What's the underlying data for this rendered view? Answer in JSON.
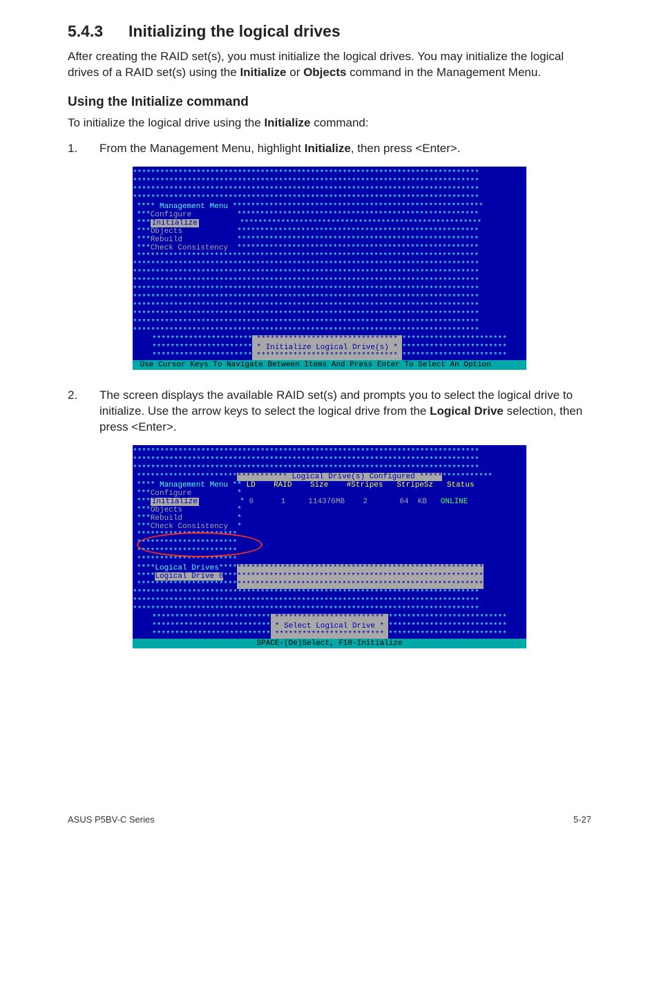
{
  "section": {
    "number": "5.4.3",
    "title": "Initializing the logical drives"
  },
  "intro": {
    "p1a": "After creating the RAID set(s), you must initialize the logical drives. You may initialize the logical drives of a RAID set(s) using the ",
    "p1b": "Initialize",
    "p1c": " or ",
    "p1d": "Objects",
    "p1e": " command in the Management Menu."
  },
  "sub": {
    "title": "Using the Initialize command",
    "lead_a": "To initialize the logical drive using the ",
    "lead_b": "Initialize",
    "lead_c": " command:"
  },
  "steps": {
    "s1": {
      "n": "1.",
      "a": "From the Management Menu, highlight ",
      "b": "Initialize",
      "c": ", then press <Enter>."
    },
    "s2": {
      "n": "2.",
      "a": "The screen displays the available RAID set(s) and prompts you to select the logical drive to initialize. Use the arrow keys to select the logical drive from the ",
      "b": "Logical Drive",
      "c": " selection, then press <Enter>."
    }
  },
  "term1": {
    "menu_header": "Management Menu",
    "items": {
      "configure": "Configure",
      "initialize": "Initialize",
      "objects": "Objects",
      "rebuild": "Rebuild",
      "check": "Check Consistency"
    },
    "msg": "Initialize Logical Drive(s)",
    "footer": " Use Cursor Keys To Navigate Between Items And Press Enter To Select An Option "
  },
  "term2": {
    "top_right": "Logical Drive(s) Configured",
    "menu_header": "Management Menu",
    "cols": {
      "ld": "LD",
      "raid": "RAID",
      "size": "Size",
      "stripes": "#Stripes",
      "stripesz": "StripeSz",
      "status": "Status"
    },
    "items": {
      "configure": "Configure",
      "initialize": "Initialize",
      "objects": "Objects",
      "rebuild": "Rebuild",
      "check": "Check Consistency"
    },
    "row": {
      "ld": "0",
      "raid": "1",
      "size": "114376MB",
      "stripes": "2",
      "stripesz": "64  KB",
      "status": "ONLINE"
    },
    "ld_box": {
      "title": "Logical Drives",
      "sel": "Logical Drive 0"
    },
    "msg": "Select Logical Drive",
    "footer": "SPACE-(De)Select, F10-Initialize"
  },
  "footer": {
    "left": "ASUS P5BV-C Series",
    "right": "5-27"
  }
}
